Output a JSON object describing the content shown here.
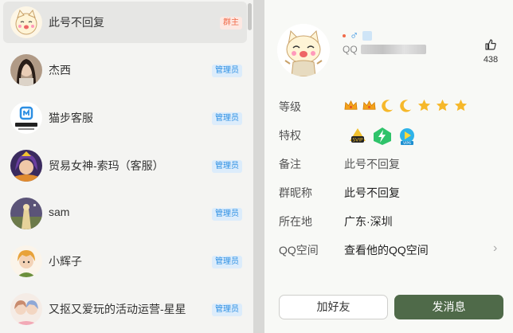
{
  "members": [
    {
      "name": "此号不回复",
      "role": "群主",
      "role_type": "owner",
      "avatar": "cartoon-cat-avatar",
      "selected": true
    },
    {
      "name": "杰西",
      "role": "管理员",
      "role_type": "admin",
      "avatar": "girl-photo-avatar"
    },
    {
      "name": "猫步客服",
      "role": "管理员",
      "role_type": "admin",
      "avatar": "maobu-logo-avatar"
    },
    {
      "name": "贸易女神-索玛（客服）",
      "role": "管理员",
      "role_type": "admin",
      "avatar": "anime-character-avatar"
    },
    {
      "name": "sam",
      "role": "管理员",
      "role_type": "admin",
      "avatar": "landscape-avatar"
    },
    {
      "name": "小辉子",
      "role": "管理员",
      "role_type": "admin",
      "avatar": "anime-boy-avatar"
    },
    {
      "name": "又抠又爱玩的活动运营-星星",
      "role": "管理员",
      "role_type": "admin",
      "avatar": "anime-girls-avatar"
    }
  ],
  "profile": {
    "qq_prefix": "QQ",
    "likes": "438",
    "labels": {
      "level": "等级",
      "privilege": "特权",
      "remark": "备注",
      "group_nickname": "群昵称",
      "location": "所在地",
      "qzone": "QQ空间"
    },
    "remark": "此号不回复",
    "group_nickname": "此号不回复",
    "location": "广东·深圳",
    "qzone_link": "查看他的QQ空间",
    "level_icons": [
      "crown-icon",
      "crown-icon",
      "moon-icon",
      "moon-icon",
      "star-icon",
      "star-icon",
      "star-icon"
    ],
    "privilege_icons": [
      "svip-icon",
      "lightning-icon",
      "vip-play-icon"
    ]
  },
  "buttons": {
    "add_friend": "加好友",
    "send_message": "发消息"
  },
  "colors": {
    "accent": "#4f6a49",
    "owner_badge": "#f06b4a",
    "admin_badge": "#2d8fe3",
    "selected_row": "#e6e6e4"
  }
}
